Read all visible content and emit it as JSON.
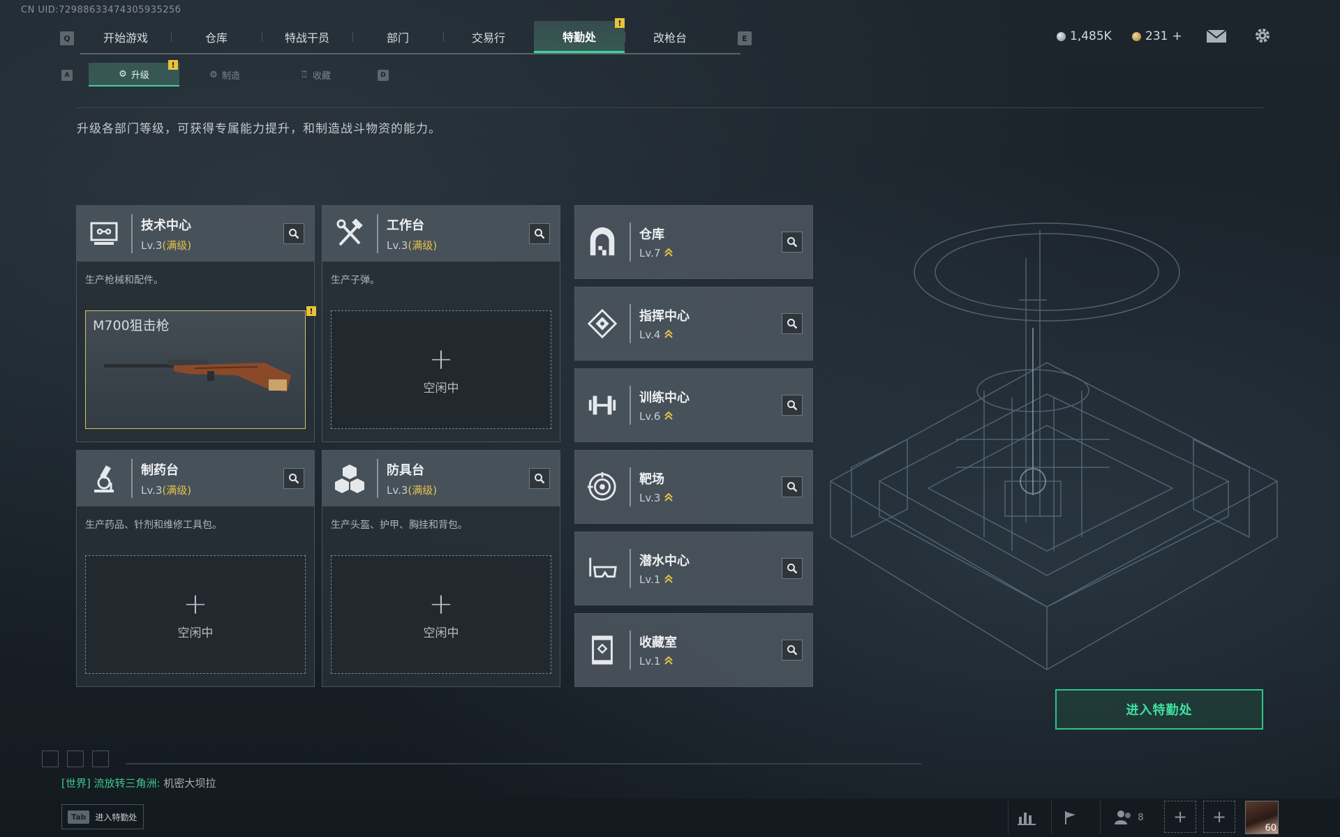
{
  "uid": "CN UID:7298863347430593525б",
  "nav": {
    "left_key": "Q",
    "right_key": "E",
    "tabs": [
      "开始游戏",
      "仓库",
      "特战干员",
      "部门",
      "交易行",
      "特勤处",
      "改枪台"
    ],
    "active_index": 5
  },
  "currency": {
    "silver": "1,485K",
    "gold": "231",
    "gold_add": "+"
  },
  "subnav": {
    "left_key": "A",
    "right_key": "D",
    "tabs": [
      "升级",
      "制造",
      "收藏"
    ],
    "active_index": 0
  },
  "description": "升级各部门等级，可获得专属能力提升，和制造战斗物资的能力。",
  "stations": [
    {
      "title": "技术中心",
      "level": "Lv.3",
      "max": "(满级)",
      "desc": "生产枪械和配件。",
      "slot_item": "M700狙击枪"
    },
    {
      "title": "工作台",
      "level": "Lv.3",
      "max": "(满级)",
      "desc": "生产子弹。",
      "slot_label": "空闲中"
    },
    {
      "title": "制药台",
      "level": "Lv.3",
      "max": "(满级)",
      "desc": "生产药品、针剂和维修工具包。",
      "slot_label": "空闲中"
    },
    {
      "title": "防具台",
      "level": "Lv.3",
      "max": "(满级)",
      "desc": "生产头盔、护甲、胸挂和背包。",
      "slot_label": "空闲中"
    }
  ],
  "facilities": [
    {
      "title": "仓库",
      "level": "Lv.7"
    },
    {
      "title": "指挥中心",
      "level": "Lv.4"
    },
    {
      "title": "训练中心",
      "level": "Lv.6"
    },
    {
      "title": "靶场",
      "level": "Lv.3"
    },
    {
      "title": "潜水中心",
      "level": "Lv.1"
    },
    {
      "title": "收藏室",
      "level": "Lv.1"
    }
  ],
  "enter_button": "进入特勤处",
  "chat": {
    "channel": "[世界]",
    "sender": "流放转三角洲:",
    "message": "机密大坝拉"
  },
  "bottom": {
    "tab_key": "Tab",
    "tab_label": "进入特勤处",
    "friends_count": "8",
    "avatar_level": "60"
  },
  "colors": {
    "accent": "#3fd39a",
    "alert": "#e8c238",
    "max_level": "#e6c24a"
  }
}
